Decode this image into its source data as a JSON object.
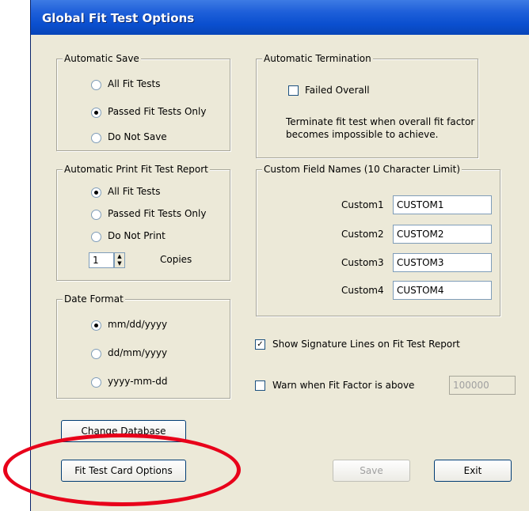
{
  "window": {
    "title": "Global Fit Test Options"
  },
  "auto_save": {
    "legend": "Automatic Save",
    "options": [
      {
        "label": "All Fit Tests",
        "selected": false
      },
      {
        "label": "Passed Fit Tests Only",
        "selected": true
      },
      {
        "label": "Do Not Save",
        "selected": false
      }
    ]
  },
  "auto_term": {
    "legend": "Automatic Termination",
    "checkbox_label": "Failed Overall",
    "checked": false,
    "description_line1": "Terminate fit test when overall fit factor",
    "description_line2": "becomes impossible to achieve."
  },
  "auto_print": {
    "legend": "Automatic Print Fit Test Report",
    "options": [
      {
        "label": "All Fit Tests",
        "selected": true
      },
      {
        "label": "Passed Fit Tests Only",
        "selected": false
      },
      {
        "label": "Do Not Print",
        "selected": false
      }
    ],
    "copies_value": "1",
    "copies_label": "Copies"
  },
  "custom_fields": {
    "legend": "Custom Field Names (10 Character Limit)",
    "fields": [
      {
        "label": "Custom1",
        "value": "CUSTOM1"
      },
      {
        "label": "Custom2",
        "value": "CUSTOM2"
      },
      {
        "label": "Custom3",
        "value": "CUSTOM3"
      },
      {
        "label": "Custom4",
        "value": "CUSTOM4"
      }
    ]
  },
  "date_format": {
    "legend": "Date Format",
    "options": [
      {
        "label": "mm/dd/yyyy",
        "selected": true
      },
      {
        "label": "dd/mm/yyyy",
        "selected": false
      },
      {
        "label": "yyyy-mm-dd",
        "selected": false
      }
    ]
  },
  "signature": {
    "label": "Show Signature Lines on Fit Test Report",
    "checked": true
  },
  "warn": {
    "label": "Warn when Fit Factor is above",
    "checked": false,
    "value": "100000"
  },
  "buttons": {
    "change_db": "Change Database",
    "card_options": "Fit Test Card Options",
    "save": "Save",
    "exit": "Exit"
  },
  "colors": {
    "titlebar": "#0a4fcf",
    "dialog": "#ece9d8",
    "highlight_oval": "#e8001a"
  }
}
